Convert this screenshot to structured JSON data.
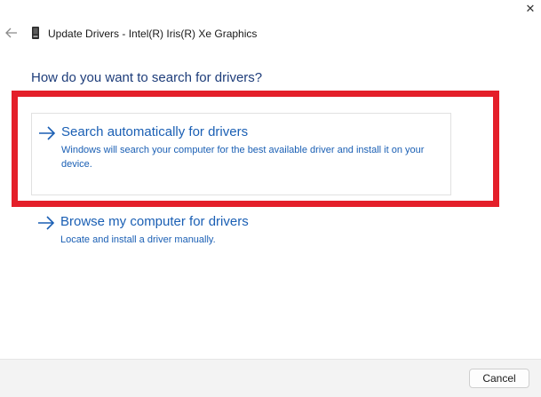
{
  "window": {
    "title": "Update Drivers - Intel(R) Iris(R) Xe Graphics",
    "close_glyph": "✕"
  },
  "heading": "How do you want to search for drivers?",
  "options": [
    {
      "title": "Search automatically for drivers",
      "description": "Windows will search your computer for the best available driver and install it on your device.",
      "icon": "arrow-right-icon"
    },
    {
      "title": "Browse my computer for drivers",
      "description": "Locate and install a driver manually.",
      "icon": "arrow-right-icon"
    }
  ],
  "footer": {
    "cancel_label": "Cancel"
  },
  "colors": {
    "link": "#1a5fb4",
    "heading": "#1e3d7a",
    "highlight": "#e41f2a",
    "footer_bg": "#f3f3f3"
  }
}
